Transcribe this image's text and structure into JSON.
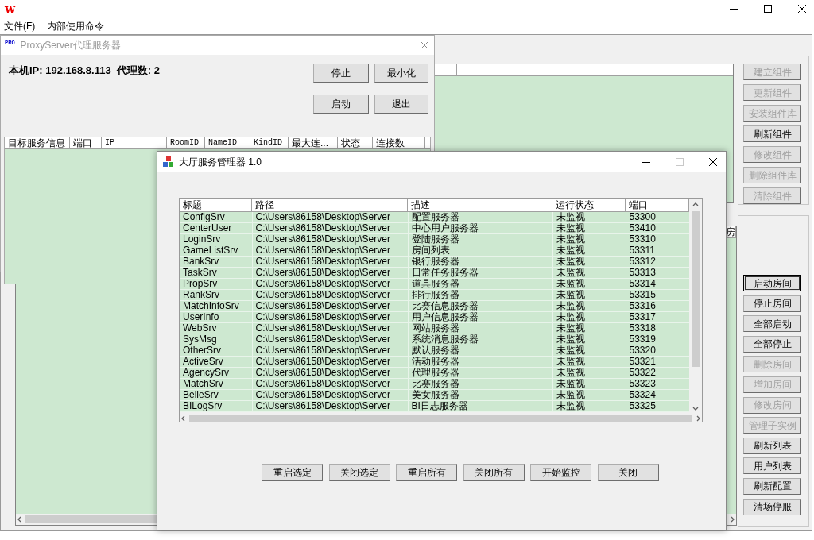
{
  "main_window": {
    "logo": "w",
    "menu": [
      "文件(F)",
      "内部使用命令"
    ],
    "component_buttons": [
      {
        "label": "建立组件",
        "disabled": true
      },
      {
        "label": "更新组件",
        "disabled": true
      },
      {
        "label": "安装组件库",
        "disabled": true
      },
      {
        "label": "刷新组件",
        "disabled": false
      },
      {
        "label": "修改组件",
        "disabled": true
      },
      {
        "label": "删除组件库",
        "disabled": true
      },
      {
        "label": "清除组件",
        "disabled": true
      }
    ],
    "room_list": {
      "columns": [
        "房"
      ]
    },
    "room_buttons": [
      {
        "label": "启动房间",
        "disabled": false,
        "focused": true
      },
      {
        "label": "停止房间",
        "disabled": false,
        "focused": false
      },
      {
        "label": "全部启动",
        "disabled": false,
        "focused": false
      },
      {
        "label": "全部停止",
        "disabled": false,
        "focused": false
      },
      {
        "label": "删除房间",
        "disabled": true,
        "focused": false
      },
      {
        "label": "增加房间",
        "disabled": true,
        "focused": false
      },
      {
        "label": "修改房间",
        "disabled": true,
        "focused": false
      },
      {
        "label": "管理子实例",
        "disabled": true,
        "focused": false
      },
      {
        "label": "刷新列表",
        "disabled": false,
        "focused": false
      },
      {
        "label": "用户列表",
        "disabled": false,
        "focused": false
      },
      {
        "label": "刷新配置",
        "disabled": false,
        "focused": false
      },
      {
        "label": "清场停服",
        "disabled": false,
        "focused": false
      }
    ]
  },
  "proxy_window": {
    "icon_text": "PRO",
    "title": "ProxyServer代理服务器",
    "info": "本机IP: 192.168.8.113  代理数: 2",
    "buttons": [
      "停止",
      "最小化",
      "启动",
      "退出"
    ],
    "table": {
      "columns": [
        "目标服务信息",
        "端口",
        "IP",
        "RoomID",
        "NameID",
        "KindID",
        "最大连...",
        "状态",
        "连接数"
      ]
    }
  },
  "dialog": {
    "title": "大厅服务管理器 1.0",
    "maximize_disabled": true,
    "table": {
      "columns": [
        "标题",
        "路径",
        "描述",
        "运行状态",
        "端口"
      ],
      "rows": [
        [
          "ConfigSrv",
          "C:\\Users\\86158\\Desktop\\Server",
          "配置服务器",
          "未监视",
          "53300"
        ],
        [
          "CenterUser",
          "C:\\Users\\86158\\Desktop\\Server",
          "中心用户服务器",
          "未监视",
          "53410"
        ],
        [
          "LoginSrv",
          "C:\\Users\\86158\\Desktop\\Server",
          "登陆服务器",
          "未监视",
          "53310"
        ],
        [
          "GameListSrv",
          "C:\\Users\\86158\\Desktop\\Server",
          "房间列表",
          "未监视",
          "53311"
        ],
        [
          "BankSrv",
          "C:\\Users\\86158\\Desktop\\Server",
          "银行服务器",
          "未监视",
          "53312"
        ],
        [
          "TaskSrv",
          "C:\\Users\\86158\\Desktop\\Server",
          "日常任务服务器",
          "未监视",
          "53313"
        ],
        [
          "PropSrv",
          "C:\\Users\\86158\\Desktop\\Server",
          "道具服务器",
          "未监视",
          "53314"
        ],
        [
          "RankSrv",
          "C:\\Users\\86158\\Desktop\\Server",
          "排行服务器",
          "未监视",
          "53315"
        ],
        [
          "MatchInfoSrv",
          "C:\\Users\\86158\\Desktop\\Server",
          "比赛信息服务器",
          "未监视",
          "53316"
        ],
        [
          "UserInfo",
          "C:\\Users\\86158\\Desktop\\Server",
          "用户信息服务器",
          "未监视",
          "53317"
        ],
        [
          "WebSrv",
          "C:\\Users\\86158\\Desktop\\Server",
          "网站服务器",
          "未监视",
          "53318"
        ],
        [
          "SysMsg",
          "C:\\Users\\86158\\Desktop\\Server",
          "系统消息服务器",
          "未监视",
          "53319"
        ],
        [
          "OtherSrv",
          "C:\\Users\\86158\\Desktop\\Server",
          "默认服务器",
          "未监视",
          "53320"
        ],
        [
          "ActiveSrv",
          "C:\\Users\\86158\\Desktop\\Server",
          "活动服务器",
          "未监视",
          "53321"
        ],
        [
          "AgencySrv",
          "C:\\Users\\86158\\Desktop\\Server",
          "代理服务器",
          "未监视",
          "53322"
        ],
        [
          "MatchSrv",
          "C:\\Users\\86158\\Desktop\\Server",
          "比赛服务器",
          "未监视",
          "53323"
        ],
        [
          "BelleSrv",
          "C:\\Users\\86158\\Desktop\\Server",
          "美女服务器",
          "未监视",
          "53324"
        ],
        [
          "BILogSrv",
          "C:\\Users\\86158\\Desktop\\Server",
          "BI日志服务器",
          "未监视",
          "53325"
        ]
      ]
    },
    "buttons": [
      "重启选定",
      "关闭选定",
      "重启所有",
      "关闭所有",
      "开始监控",
      "关闭"
    ]
  }
}
